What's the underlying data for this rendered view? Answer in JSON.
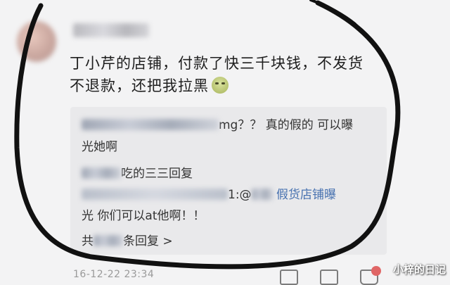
{
  "post": {
    "text_line1": "丁小芹的店铺，付款了快三千块钱，不发货",
    "text_line2": "不退款，还把我拉黑"
  },
  "replies": {
    "r1_suffix": "mg？？ 真的假的 可以曝",
    "r1_line2": "光她啊",
    "r2_suffix": "吃的三三回复",
    "r3_mid": "1:@",
    "r3_link": "假货店铺曝",
    "r3_line2": "光 你们可以at他啊！！",
    "more_prefix": "共",
    "more_suffix": "条回复 >"
  },
  "footer": {
    "timestamp": "16-12-22 23:34"
  },
  "watermark": {
    "text": "小梓的日记"
  },
  "icons": [
    "repost-icon",
    "comment-icon",
    "like-icon"
  ],
  "colors": {
    "link": "#4872b0",
    "circle": "#111111",
    "background": "#f3f3f4"
  }
}
